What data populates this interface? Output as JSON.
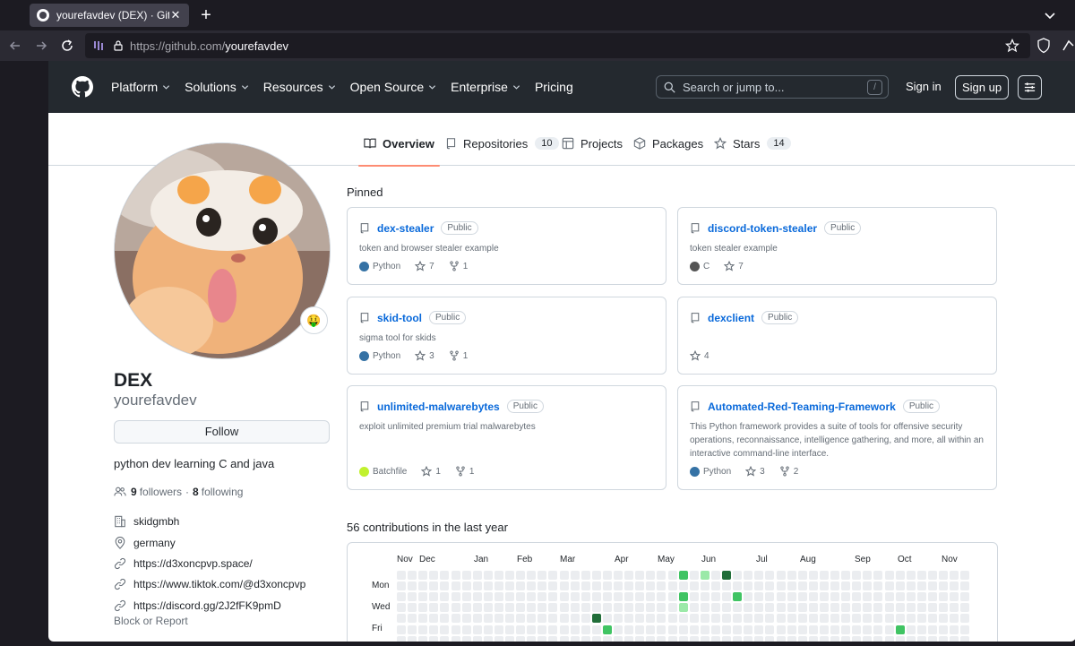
{
  "browser": {
    "tab_title": "yourefavdev (DEX) · GitHub",
    "url_host": "https://github.com/",
    "url_path": "yourefavdev"
  },
  "header": {
    "nav": [
      "Platform",
      "Solutions",
      "Resources",
      "Open Source",
      "Enterprise",
      "Pricing"
    ],
    "nav_dropdown": [
      true,
      true,
      true,
      true,
      true,
      false
    ],
    "search_placeholder": "Search or jump to...",
    "search_shortcut": "/",
    "signin": "Sign in",
    "signup": "Sign up"
  },
  "tabs": [
    {
      "label": "Overview",
      "count": "",
      "icon": "book-icon"
    },
    {
      "label": "Repositories",
      "count": "10",
      "icon": "repo-icon"
    },
    {
      "label": "Projects",
      "count": "",
      "icon": "table-icon"
    },
    {
      "label": "Packages",
      "count": "",
      "icon": "package-icon"
    },
    {
      "label": "Stars",
      "count": "14",
      "icon": "star-icon"
    }
  ],
  "profile": {
    "name": "DEX",
    "login": "yourefavdev",
    "follow_label": "Follow",
    "bio": "python dev learning C and java",
    "followers_count": "9",
    "followers_label": "followers",
    "separator": "·",
    "following_count": "8",
    "following_label": "following",
    "emoji_status": "🤑",
    "company": "skidgmbh",
    "location": "germany",
    "links": [
      "https://d3xoncpvp.space/",
      "https://www.tiktok.com/@d3xoncpvp",
      "https://discord.gg/2J2fFK9pmD"
    ],
    "block_report": "Block or Report"
  },
  "pinned": {
    "title": "Pinned",
    "repos": [
      {
        "name": "dex-stealer",
        "badge": "Public",
        "desc": "token and browser stealer example",
        "lang": "Python",
        "lang_color": "#3572A5",
        "stars": "7",
        "forks": "1"
      },
      {
        "name": "discord-token-stealer",
        "badge": "Public",
        "desc": "token stealer example",
        "lang": "C",
        "lang_color": "#555555",
        "stars": "7",
        "forks": ""
      },
      {
        "name": "skid-tool",
        "badge": "Public",
        "desc": "sigma tool for skids",
        "lang": "Python",
        "lang_color": "#3572A5",
        "stars": "3",
        "forks": "1"
      },
      {
        "name": "dexclient",
        "badge": "Public",
        "desc": "",
        "lang": "",
        "lang_color": "",
        "stars": "4",
        "forks": ""
      },
      {
        "name": "unlimited-malwarebytes",
        "badge": "Public",
        "desc": "exploit unlimited premium trial malwarebytes",
        "lang": "Batchfile",
        "lang_color": "#C1F12E",
        "stars": "1",
        "forks": "1"
      },
      {
        "name": "Automated-Red-Teaming-Framework",
        "badge": "Public",
        "desc": "This Python framework provides a suite of tools for offensive security operations, reconnaissance, intelligence gathering, and more, all within an interactive command-line interface.",
        "lang": "Python",
        "lang_color": "#3572A5",
        "stars": "3",
        "forks": "2"
      }
    ]
  },
  "contributions": {
    "title": "56 contributions in the last year",
    "months": [
      "Nov",
      "Dec",
      "Jan",
      "Feb",
      "Mar",
      "Apr",
      "May",
      "Jun",
      "Jul",
      "Aug",
      "Sep",
      "Oct",
      "Nov"
    ],
    "day_labels": [
      "Mon",
      "Wed",
      "Fri"
    ],
    "levels_colors": [
      "#ebedf0",
      "#9be9a8",
      "#40c463",
      "#30a14e",
      "#216e39"
    ],
    "active_cells": [
      {
        "week": 26,
        "day": 0,
        "level": 2
      },
      {
        "week": 28,
        "day": 0,
        "level": 1
      },
      {
        "week": 30,
        "day": 0,
        "level": 4
      },
      {
        "week": 26,
        "day": 2,
        "level": 2
      },
      {
        "week": 31,
        "day": 2,
        "level": 2
      },
      {
        "week": 26,
        "day": 3,
        "level": 1
      },
      {
        "week": 18,
        "day": 4,
        "level": 4
      },
      {
        "week": 19,
        "day": 5,
        "level": 2
      },
      {
        "week": 46,
        "day": 5,
        "level": 2
      }
    ]
  }
}
